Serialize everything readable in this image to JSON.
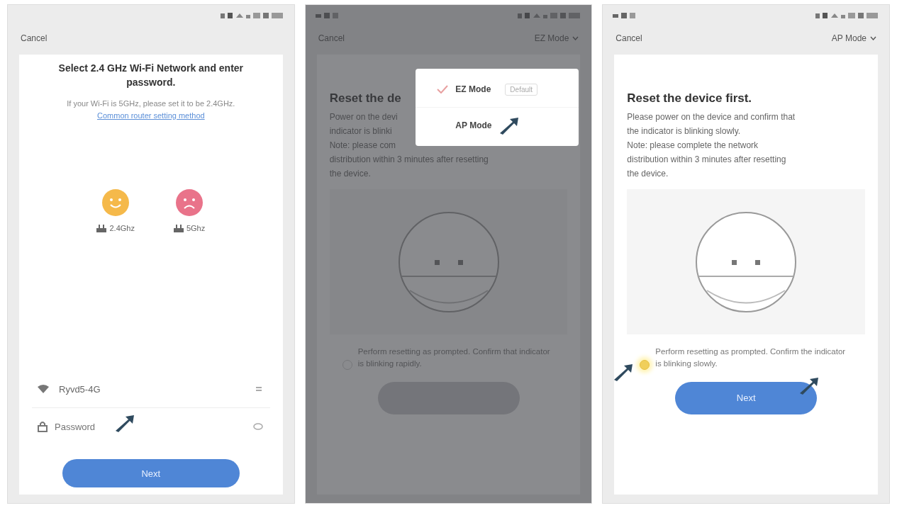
{
  "screens": [
    {
      "kind": "wifi",
      "dimmed": false,
      "nav": {
        "left": "Cancel"
      },
      "title": "Select 2.4 GHz Wi-Fi Network and enter password.",
      "hint": "If your Wi-Fi is 5GHz, please set it to be 2.4GHz.",
      "hint_link": "Common router setting method",
      "bands": [
        {
          "label": "2.4Ghz",
          "supported": true,
          "color": "#f5b94a"
        },
        {
          "label": "5Ghz",
          "supported": false,
          "color": "#e9738a"
        }
      ],
      "network": "Ryvd5-4G",
      "password": {
        "placeholder": "Password",
        "pointer": true
      },
      "button": {
        "label": "Next",
        "enabled": true
      }
    },
    {
      "kind": "reset",
      "dimmed": true,
      "nav": {
        "left": "Cancel",
        "mode": "EZ Mode"
      },
      "title": "Reset the de",
      "body_lines": [
        "Power on the devi",
        "indicator is blinki",
        "Note: please com",
        "distribution within 3 minutes after resetting",
        "the device."
      ],
      "menu": [
        {
          "label": "EZ Mode",
          "selected": true,
          "tag": "Default"
        },
        {
          "label": "AP Mode",
          "selected": false,
          "pointer": true
        }
      ],
      "confirm": {
        "text": "Perform resetting as prompted. Confirm that indicator is blinking rapidly.",
        "highlighted": false
      },
      "button": {
        "enabled": false
      }
    },
    {
      "kind": "reset",
      "dimmed": false,
      "nav": {
        "left": "Cancel",
        "mode": "AP Mode"
      },
      "title": "Reset the device first.",
      "body_lines": [
        "Please power on the device and confirm that",
        "the indicator is blinking slowly.",
        "Note: please complete the network",
        "distribution within 3 minutes after resetting",
        "the device."
      ],
      "confirm": {
        "text": "Perform resetting as prompted. Confirm the indicator is blinking slowly.",
        "highlighted": true,
        "pointer": true
      },
      "button": {
        "label": "Next",
        "enabled": true,
        "pointer": true
      }
    }
  ]
}
